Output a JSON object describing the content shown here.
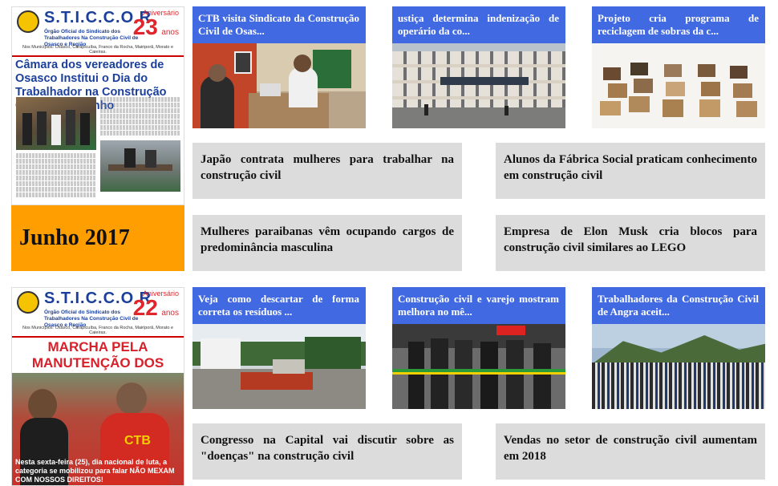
{
  "covers": [
    {
      "brand": "S.T.I.C.C.O.R",
      "anniversary_label": "Aniversário",
      "anniversary_number": "23",
      "anniversary_unit": "anos",
      "subtitle": "Órgão Oficial do Sindicato dos Trabalhadores Na Construção Civil de Osasco e Região",
      "municipalities": "Nos Municípios: Osasco, Carapicuíba, Franco da Rocha, Mairiporã, Morato e Caieiras.",
      "headline": "Câmara dos vereadores de Osasco Institui o Dia do Trabalhador na Construção Civil, 13 de Junho"
    },
    {
      "brand": "S.T.I.C.C.O.R",
      "anniversary_label": "Aniversário",
      "anniversary_number": "22",
      "anniversary_unit": "anos",
      "subtitle": "Órgão Oficial do Sindicato dos Trabalhadores Na Construção Civil de Osasco e Região",
      "municipalities": "Nos Municípios: Osasco, Carapicuíba, Franco da Rocha, Mairiporã, Morato e Caieiras.",
      "headline": "MARCHA PELA MANUTENÇÃO DOS DIREITOS - FORA TEMER!",
      "shirt_text": "CTB",
      "footer_text": "Nesta sexta-feira (25), dia nacional de luta, a categoria se mobilizou para falar NÃO MEXAM COM NOSSOS DIREITOS!"
    }
  ],
  "month_label": "Junho 2017",
  "top_cards": [
    {
      "caption": "CTB visita Sindicato da Construção Civil de Osas...",
      "image": "office-meeting-photo"
    },
    {
      "caption": "ustiça determina indenização de operário da co...",
      "image": "court-building-photo"
    },
    {
      "caption": "Projeto cria programa de reciclagem de sobras da c...",
      "image": "recycled-blocks-photo"
    }
  ],
  "bottom_cards": [
    {
      "caption": "Veja como descartar de forma correta os resíduos ...",
      "image": "waste-site-photo"
    },
    {
      "caption": "Construção civil e varejo mostram melhora no mê...",
      "image": "ribbon-cutting-photo"
    },
    {
      "caption": "Trabalhadores da Construção Civil de Angra aceit...",
      "image": "workers-assembly-photo"
    }
  ],
  "headlines_row1": [
    "Japão contrata mulheres para trabalhar na construção civil",
    "Alunos da Fábrica Social praticam conhecimento em construção civil"
  ],
  "headlines_row2": [
    "Mulheres paraibanas vêm ocupando cargos de predominância masculina",
    "Empresa de Elon Musk cria blocos para construção civil similares ao LEGO"
  ],
  "headlines_row3": [
    "Congresso na Capital vai discutir sobre as \"doenças\" na construção civil",
    "Vendas no setor de construção civil aumentam em 2018"
  ],
  "colors": {
    "caption_bg": "#4169e1",
    "month_bg": "#ff9e00",
    "headline_bg": "#dcdcdc",
    "brand_blue": "#1b3f9a",
    "anniversary_red": "#e0262c"
  }
}
